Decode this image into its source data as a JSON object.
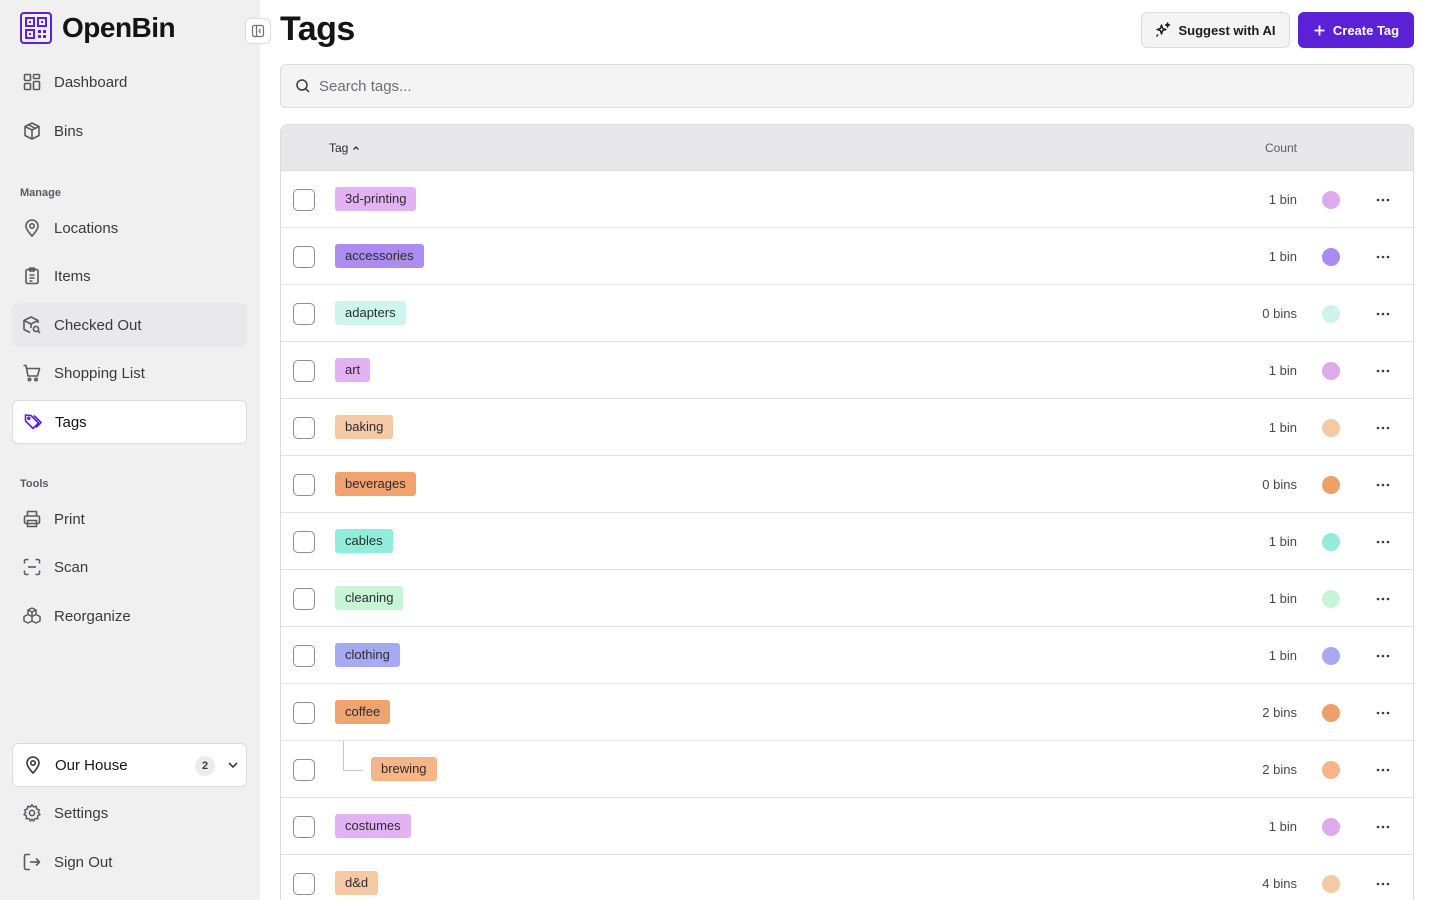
{
  "brand": {
    "name": "OpenBin"
  },
  "nav": {
    "dashboard": "Dashboard",
    "bins": "Bins",
    "manage_heading": "Manage",
    "locations": "Locations",
    "items": "Items",
    "checked_out": "Checked Out",
    "shopping_list": "Shopping List",
    "tags": "Tags",
    "tools_heading": "Tools",
    "print": "Print",
    "scan": "Scan",
    "reorganize": "Reorganize"
  },
  "location_switcher": {
    "name": "Our House",
    "badge": "2"
  },
  "footer_nav": {
    "settings": "Settings",
    "sign_out": "Sign Out"
  },
  "page": {
    "title": "Tags",
    "suggest_label": "Suggest with AI",
    "create_label": "Create Tag",
    "search_placeholder": "Search tags..."
  },
  "table": {
    "col_tag": "Tag",
    "col_count": "Count",
    "rows": [
      {
        "name": "3d-printing",
        "count": "1 bin",
        "chip": "#e3b2f3",
        "dot": "#ddaaf0",
        "child": false
      },
      {
        "name": "accessories",
        "count": "1 bin",
        "chip": "#ad8cf0",
        "dot": "#a88af0",
        "child": false
      },
      {
        "name": "adapters",
        "count": "0 bins",
        "chip": "#cdf5ea",
        "dot": "#cdf5ea",
        "child": false
      },
      {
        "name": "art",
        "count": "1 bin",
        "chip": "#e3b2f3",
        "dot": "#ddaaf0",
        "child": false
      },
      {
        "name": "baking",
        "count": "1 bin",
        "chip": "#f5c9a4",
        "dot": "#f5c9a4",
        "child": false
      },
      {
        "name": "beverages",
        "count": "0 bins",
        "chip": "#f0a36e",
        "dot": "#ef9f68",
        "child": false
      },
      {
        "name": "cables",
        "count": "1 bin",
        "chip": "#93ecd9",
        "dot": "#93ecd9",
        "child": false
      },
      {
        "name": "cleaning",
        "count": "1 bin",
        "chip": "#c8f5d6",
        "dot": "#c8f5d6",
        "child": false
      },
      {
        "name": "clothing",
        "count": "1 bin",
        "chip": "#a6a9f3",
        "dot": "#a6a9f3",
        "child": false
      },
      {
        "name": "coffee",
        "count": "2 bins",
        "chip": "#f0a36e",
        "dot": "#ef9f68",
        "child": false
      },
      {
        "name": "brewing",
        "count": "2 bins",
        "chip": "#f5b588",
        "dot": "#f5b588",
        "child": true
      },
      {
        "name": "costumes",
        "count": "1 bin",
        "chip": "#e3b2f3",
        "dot": "#ddaaf0",
        "child": false
      },
      {
        "name": "d&d",
        "count": "4 bins",
        "chip": "#f5c9a4",
        "dot": "#f5c9a4",
        "child": false
      }
    ]
  }
}
